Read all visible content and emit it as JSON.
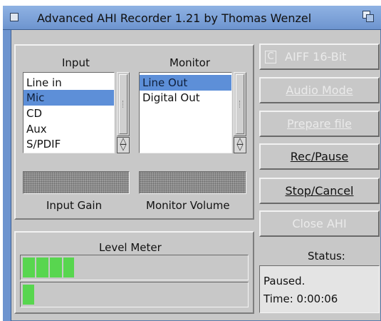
{
  "window": {
    "title": "Advanced AHI Recorder 1.21 by Thomas Wenzel"
  },
  "input": {
    "heading": "Input",
    "items": [
      "Line in",
      "Mic",
      "CD",
      "Aux",
      "S/PDIF"
    ],
    "selected": "Mic"
  },
  "monitor": {
    "heading": "Monitor",
    "items": [
      "Line Out",
      "Digital Out"
    ],
    "selected": "Line Out"
  },
  "sliders": {
    "input_gain_label": "Input Gain",
    "monitor_volume_label": "Monitor Volume"
  },
  "level_meter": {
    "heading": "Level Meter",
    "left_level": 0.23,
    "right_level": 0.05,
    "fill_color": "#58d64f"
  },
  "buttons": {
    "format": "AIFF 16-Bit",
    "audio_mode": "Audio Mode",
    "prepare_file": "Prepare file",
    "rec_pause": "Rec/Pause",
    "stop_cancel": "Stop/Cancel",
    "close_ahi": "Close AHI"
  },
  "status": {
    "heading": "Status:",
    "state": "Paused.",
    "time": "Time: 0:00:06"
  },
  "colors": {
    "titlebar": "#7ea4da",
    "selection": "#5d8fd8",
    "panel": "#c8c8c8"
  }
}
